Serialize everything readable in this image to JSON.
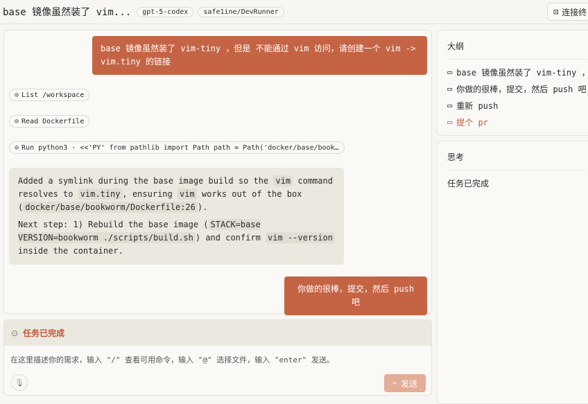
{
  "header": {
    "title": "base 镜像虽然装了 vim...",
    "model_chip": "gpt-5-codex",
    "repo_chip": "safe1ine/DevRunner",
    "connect_label": "连接终"
  },
  "chat": {
    "user_message_1": "base 镜像虽然装了 vim-tiny ，但是 不能通过 vim 访问，请创建一个 vim -> vim.tiny 的链接",
    "tools": [
      "List /workspace",
      "Read Dockerfile",
      "Run python3 - <<'PY' from pathlib import Path path = Path('docker/base/book…"
    ],
    "reply": {
      "p1": [
        "Added a symlink during the base image build so the ",
        "vim",
        " command resolves to ",
        "vim.tiny",
        ", ensuring ",
        "vim",
        " works out of the box (",
        "docker/base/bookworm/Dockerfile:26",
        ")."
      ],
      "p2": [
        "Next step: 1) Rebuild the base image (",
        "STACK=base VERSION=bookworm ./scripts/build.sh",
        ") and confirm ",
        "vim --version",
        " inside the container."
      ]
    },
    "user_message_2": "你做的很棒，提交，然后 push 吧"
  },
  "input": {
    "status": "任务已完成",
    "placeholder": "在这里描述你的需求，输入 \"/\" 查看可用命令，输入 \"@\" 选择文件，输入 \"enter\" 发送。",
    "send_label": "发送"
  },
  "outline": {
    "title": "大纲",
    "items": [
      "base 镜像虽然装了 vim-tiny ，",
      "你做的很棒，提交，然后 push 吧",
      "重新 push",
      "提个 pr"
    ]
  },
  "thinking": {
    "title": "思考",
    "text": "任务已完成"
  },
  "colors": {
    "accent": "#c46445",
    "panel": "#ebe8df"
  }
}
